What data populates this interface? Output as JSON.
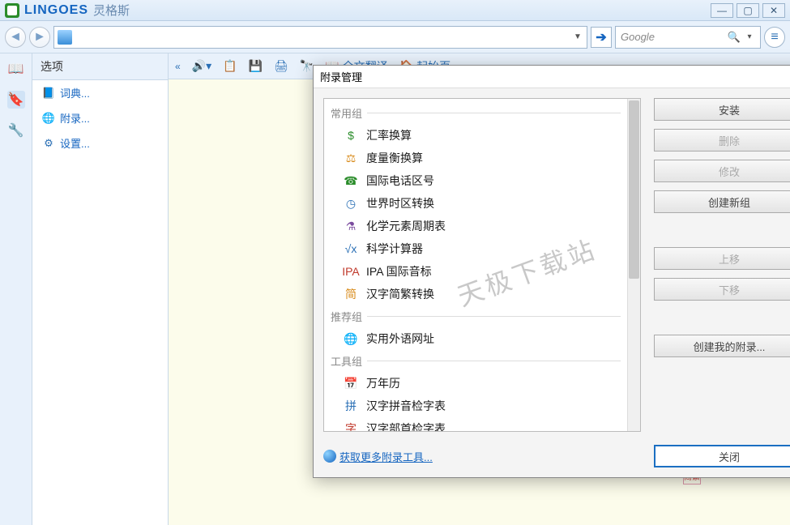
{
  "title": {
    "brand": "LINGOES",
    "brand_cn": "灵格斯"
  },
  "search": {
    "value": "",
    "google_ph": "Google"
  },
  "toolbar": {
    "fulltext": "全文翻译",
    "startpage": "起始页"
  },
  "sidebar": {
    "header": "选项",
    "items": [
      {
        "label": "词典...",
        "icon": "book-icon"
      },
      {
        "label": "附录...",
        "icon": "globe-icon"
      },
      {
        "label": "设置...",
        "icon": "gear-icon"
      }
    ]
  },
  "dialog": {
    "title": "附录管理",
    "groups": [
      {
        "label": "常用组",
        "items": [
          {
            "label": "汇率换算",
            "icon": "dollar-icon",
            "cls": "c-green"
          },
          {
            "label": "度量衡换算",
            "icon": "scale-icon",
            "cls": "c-orange"
          },
          {
            "label": "国际电话区号",
            "icon": "phone-icon",
            "cls": "c-green"
          },
          {
            "label": "世界时区转换",
            "icon": "clock-icon",
            "cls": "c-blue"
          },
          {
            "label": "化学元素周期表",
            "icon": "flask-icon",
            "cls": "c-purple"
          },
          {
            "label": "科学计算器",
            "icon": "calc-icon",
            "cls": "c-blue"
          },
          {
            "label": "IPA 国际音标",
            "icon": "ipa-icon",
            "cls": "c-red"
          },
          {
            "label": "汉字简繁转换",
            "icon": "hanzi-icon",
            "cls": "c-orange"
          }
        ]
      },
      {
        "label": "推荐组",
        "items": [
          {
            "label": "实用外语网址",
            "icon": "globe-icon",
            "cls": "c-blue"
          }
        ]
      },
      {
        "label": "工具组",
        "items": [
          {
            "label": "万年历",
            "icon": "calendar-icon",
            "cls": "c-orange"
          },
          {
            "label": "汉字拼音检字表",
            "icon": "pinyin-icon",
            "cls": "c-blue"
          },
          {
            "label": "汉字部首检字表",
            "icon": "radical-icon",
            "cls": "c-red"
          }
        ]
      }
    ],
    "buttons": {
      "install": "安装",
      "delete": "删除",
      "modify": "修改",
      "newgroup": "创建新组",
      "moveup": "上移",
      "movedown": "下移",
      "createmy": "创建我的附录...",
      "close": "关闭"
    },
    "more_link": "获取更多附录工具..."
  },
  "watermark": "天极下载站",
  "stamp": "简繁"
}
